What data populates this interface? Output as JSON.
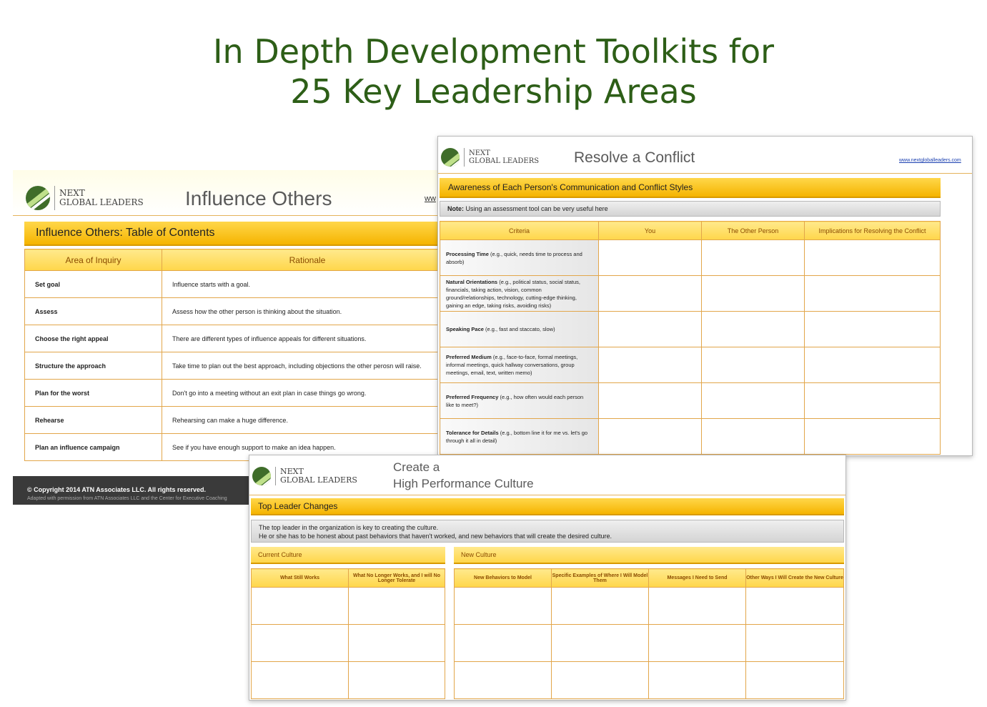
{
  "headline": {
    "line1": "In Depth Development Toolkits for",
    "line2": "25 Key Leadership Areas"
  },
  "brand": {
    "line1": "NEXT",
    "line2": "GLOBAL LEADERS",
    "reg": "®"
  },
  "influence": {
    "title": "Influence Others",
    "url_fragment": "ww",
    "section_title": "Influence Others: Table of Contents",
    "headers": [
      "Area of Inquiry",
      "Rationale"
    ],
    "rows": [
      {
        "area": "Set goal",
        "rationale": "Influence starts with a goal."
      },
      {
        "area": "Assess",
        "rationale": "Assess how the other person is thinking about the situation."
      },
      {
        "area": "Choose the right appeal",
        "rationale": "There are different types of influence appeals for different situations."
      },
      {
        "area": "Structure the approach",
        "rationale": "Take time to plan out the best approach, including objections the other perosn will raise."
      },
      {
        "area": "Plan for the worst",
        "rationale": "Don't go into a meeting without an exit plan in case things go wrong."
      },
      {
        "area": "Rehearse",
        "rationale": "Rehearsing can make a huge difference."
      },
      {
        "area": "Plan an influence campaign",
        "rationale": "See if you have enough support to make an idea happen."
      }
    ],
    "copyright": "© Copyright 2014 ATN Associates LLC. All rights reserved.",
    "adapted": "Adapted with permission from ATN Associates LLC and the Center for Executive Coaching"
  },
  "conflict": {
    "title": "Resolve a Conflict",
    "url": "www.nextgloballeaders.com",
    "section_title": "Awareness of Each Person's Communication and Conflict Styles",
    "note_label": "Note:",
    "note": " Using an assessment tool can be very useful here",
    "headers": [
      "Criteria",
      "You",
      "The Other Person",
      "Implications for Resolving the Conflict"
    ],
    "rows": [
      {
        "label": "Processing Time",
        "detail": " (e.g., quick, needs time to process and absorb)"
      },
      {
        "label": "Natural Orientations",
        "detail": " (e.g., political status, social status, financials, taking action, vision, common ground/relationships, technology, cutting-edge thinking, gaining an edge, taking risks, avoiding risks)"
      },
      {
        "label": "Speaking Pace",
        "detail": " (e.g., fast and staccato, slow)"
      },
      {
        "label": "Preferred Medium",
        "detail": " (e.g., face-to-face, formal meetings, informal meetings, quick hallway conversations, group meetings, email, text, written memo)"
      },
      {
        "label": "Preferred Frequency",
        "detail": " (e.g., how often would each person like to meet?)"
      },
      {
        "label": "Tolerance for Details",
        "detail": " (e.g., bottom line it for me vs. let's go through it all in detail)"
      }
    ]
  },
  "culture": {
    "title_line1": "Create a",
    "title_line2": "High Performance Culture",
    "section_title": "Top Leader Changes",
    "note_line1": "The top leader in the organization is key to creating the culture.",
    "note_line2": "He or she has to be honest about past behaviors that haven't worked, and new behaviors that will create the desired culture.",
    "current_label": "Current Culture",
    "new_label": "New Culture",
    "current_headers": [
      "What Still Works",
      "What No Longer Works, and I will No Longer Tolerate"
    ],
    "new_headers": [
      "New Behaviors to Model",
      "Specific Examples of Where I Will Model Them",
      "Messages I Need to Send",
      "Other Ways I Will Create the New Culture"
    ]
  }
}
